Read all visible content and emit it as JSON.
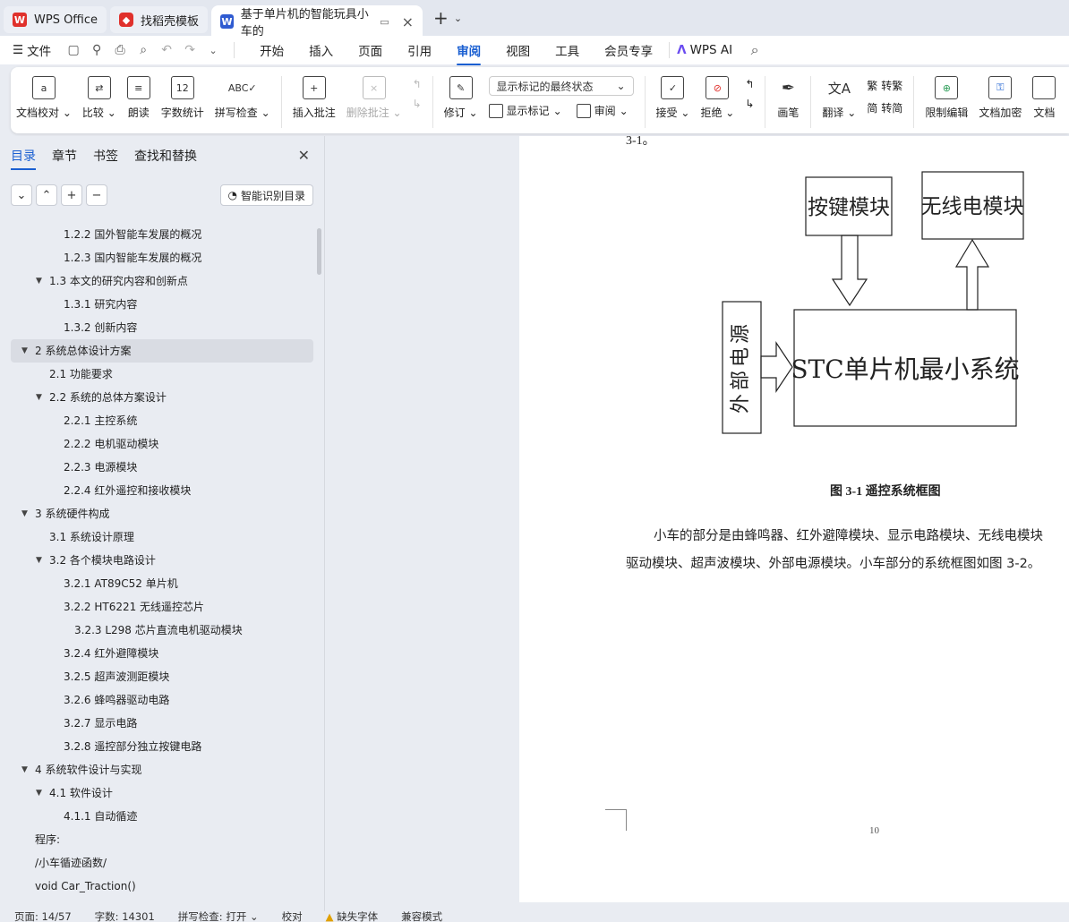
{
  "tabs": [
    {
      "label": "WPS Office",
      "icon": "wps-logo-icon"
    },
    {
      "label": "找稻壳模板",
      "icon": "docer-icon"
    },
    {
      "label": "基于单片机的智能玩具小车的",
      "icon": "word-doc-icon"
    }
  ],
  "menu": {
    "file": "文件",
    "tabs": [
      "开始",
      "插入",
      "页面",
      "引用",
      "审阅",
      "视图",
      "工具",
      "会员专享"
    ],
    "active": "审阅",
    "ai": "WPS AI"
  },
  "ribbon": {
    "doc_check": "文档校对",
    "compare": "比较",
    "read_aloud": "朗读",
    "word_count": "字数统计",
    "spell_check": "拼写检查",
    "insert_comment": "插入批注",
    "delete_comment": "删除批注",
    "revise": "修订",
    "markup_state": "显示标记的最终状态",
    "show_markup": "显示标记",
    "review": "审阅",
    "accept": "接受",
    "reject": "拒绝",
    "pen": "画笔",
    "translate": "翻译",
    "to_traditional": "转繁",
    "to_simplified": "转简",
    "restrict_edit": "限制编辑",
    "encrypt": "文档加密",
    "doc_more": "文档"
  },
  "pane": {
    "tabs": [
      "目录",
      "章节",
      "书签",
      "查找和替换"
    ],
    "smart_toc": "智能识别目录",
    "toc": [
      {
        "text": "1.2.2  国外智能车发展的概况",
        "level": 3
      },
      {
        "text": "1.2.3  国内智能车发展的概况",
        "level": 3
      },
      {
        "text": "1.3  本文的研究内容和创新点",
        "level": 2,
        "arrow": true
      },
      {
        "text": "1.3.1  研究内容",
        "level": 3
      },
      {
        "text": "1.3.2  创新内容",
        "level": 3
      },
      {
        "text": "2  系统总体设计方案",
        "level": 1,
        "arrow": true,
        "selected": true
      },
      {
        "text": "2.1 功能要求",
        "level": 2
      },
      {
        "text": "2.2 系统的总体方案设计",
        "level": 2,
        "arrow": true
      },
      {
        "text": "2.2.1 主控系统",
        "level": 3
      },
      {
        "text": "2.2.2 电机驱动模块",
        "level": 3
      },
      {
        "text": "2.2.3 电源模块",
        "level": 3
      },
      {
        "text": "2.2.4  红外遥控和接收模块",
        "level": 3
      },
      {
        "text": "3  系统硬件构成",
        "level": 1,
        "arrow": true
      },
      {
        "text": "3.1  系统设计原理",
        "level": 2
      },
      {
        "text": "3.2  各个模块电路设计",
        "level": 2,
        "arrow": true
      },
      {
        "text": "3.2.1 AT89C52 单片机",
        "level": 3
      },
      {
        "text": "3.2.2 HT6221 无线遥控芯片",
        "level": 3
      },
      {
        "text": "3.2.3 L298 芯片直流电机驱动模块",
        "level": 4
      },
      {
        "text": "3.2.4  红外避障模块",
        "level": 3
      },
      {
        "text": "3.2.5  超声波测距模块",
        "level": 3
      },
      {
        "text": "3.2.6  蜂鸣器驱动电路",
        "level": 3
      },
      {
        "text": "3.2.7  显示电路",
        "level": 3
      },
      {
        "text": "3.2.8  遥控部分独立按键电路",
        "level": 3
      },
      {
        "text": "4  系统软件设计与实现",
        "level": 1,
        "arrow": true
      },
      {
        "text": "4.1 软件设计",
        "level": 2,
        "arrow": true
      },
      {
        "text": "4.1.1 自动循迹",
        "level": 3
      },
      {
        "text": "程序:",
        "level": 0
      },
      {
        "text": "/小车循迹函数/",
        "level": 0
      },
      {
        "text": "void Car_Traction()",
        "level": 0
      }
    ]
  },
  "document": {
    "top_fragment": "3-1。",
    "diagram": {
      "keys": "按键模块",
      "radio": "无线电模块",
      "power": "外部电源",
      "mcu": "STC单片机最小系统"
    },
    "caption": "图 3-1  遥控系统框图",
    "para_line1": "小车的部分是由蜂鸣器、红外避障模块、显示电路模块、无线电模块",
    "para_line2": "驱动模块、超声波模块、外部电源模块。小车部分的系统框图如图 3-2。",
    "page_number": "10"
  },
  "status": {
    "page": "页面: 14/57",
    "words": "字数: 14301",
    "spell": "拼写检查: 打开",
    "proof": "校对",
    "missing_font": "缺失字体",
    "compat": "兼容模式"
  },
  "colors": {
    "accent": "#1a5fd1",
    "wps_red": "#e0312c",
    "word_blue": "#2f5bd1"
  }
}
